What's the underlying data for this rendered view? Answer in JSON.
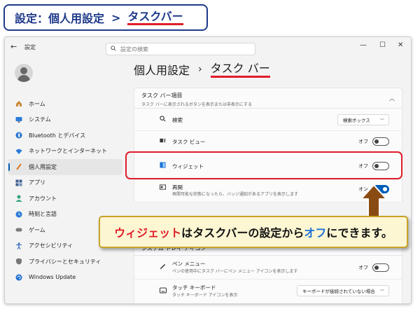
{
  "banner": {
    "part1": "設定：個人用設定",
    "separator": ">",
    "part2": "タスクバー"
  },
  "window": {
    "back_icon": "←",
    "title": "設定",
    "search_placeholder": "設定の検索",
    "controls": [
      "—",
      "☐",
      "✕"
    ]
  },
  "sidebar": {
    "items": [
      {
        "label": "ホーム",
        "icon": "home-icon"
      },
      {
        "label": "システム",
        "icon": "monitor-icon"
      },
      {
        "label": "Bluetooth とデバイス",
        "icon": "bluetooth-icon"
      },
      {
        "label": "ネットワークとインターネット",
        "icon": "wifi-icon"
      },
      {
        "label": "個人用設定",
        "icon": "brush-icon",
        "active": true
      },
      {
        "label": "アプリ",
        "icon": "apps-icon"
      },
      {
        "label": "アカウント",
        "icon": "person-icon"
      },
      {
        "label": "時刻と言語",
        "icon": "globe-icon"
      },
      {
        "label": "ゲーム",
        "icon": "gamepad-icon"
      },
      {
        "label": "アクセシビリティ",
        "icon": "accessibility-icon"
      },
      {
        "label": "プライバシーとセキュリティ",
        "icon": "shield-icon"
      },
      {
        "label": "Windows Update",
        "icon": "update-icon"
      }
    ]
  },
  "main": {
    "breadcrumb_parent": "個人用設定",
    "breadcrumb_sep": "›",
    "breadcrumb_current": "タスク バー",
    "section_title": "タスク バー項目",
    "section_desc": "タスク バーに表示されるボタンを表示または非表示にする",
    "rows": {
      "search": {
        "label": "検索",
        "value": "検索ボックス"
      },
      "taskview": {
        "label": "タスク ビュー",
        "state": "オフ"
      },
      "widget": {
        "label": "ウィジェット",
        "state": "オフ"
      },
      "resume": {
        "label": "再開",
        "desc": "再開可能な状態になったら、バッジ通知があるアプリを表示します",
        "state": "オン"
      },
      "pen": {
        "label": "ペン メニュー",
        "desc": "ペンの使用中にタスク バーにペン メニュー アイコンを表示します",
        "state": "オフ"
      },
      "touchkb": {
        "label": "タッチ キーボード",
        "desc": "タッチ キーボード アイコンを表示",
        "value": "キーボードが接続されていない場合"
      }
    },
    "section2_title": "システム トレイ アイコン"
  },
  "callout": {
    "p1": "ウィジェット",
    "p2": "は",
    "p3": "タスクバーの設定",
    "p4": "から",
    "p5": "オフ",
    "p6": "にできます。"
  },
  "colors": {
    "accent_red": "#e11d2a",
    "accent_blue": "#1d6fd6",
    "windows_blue": "#005fb8",
    "callout_bg": "#fdf6d3",
    "banner_border": "#1e3a8a"
  }
}
